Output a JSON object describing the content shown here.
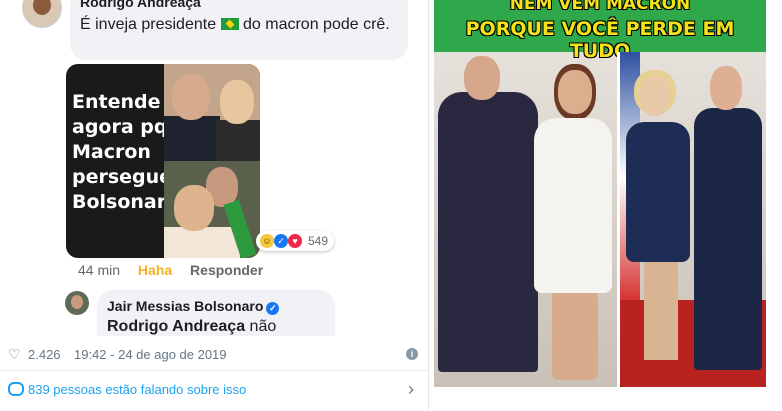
{
  "comment_1": {
    "author": "Rodrigo Andreaça",
    "text_before_flag": "É inveja presidente",
    "text_after_flag": "do macron pode crê."
  },
  "meme": {
    "text": "Entende agora pq Macron persegue Bolsonaro?"
  },
  "reactions": {
    "count": "549",
    "icons": [
      "haha-icon",
      "like-icon",
      "love-icon"
    ]
  },
  "comment_actions": {
    "time": "44 min",
    "reaction": "Haha",
    "reply": "Responder"
  },
  "comment_2": {
    "author": "Jair Messias Bolsonaro",
    "mention": "Rodrigo Andreaça",
    "text": "não"
  },
  "tweet_meta": {
    "likes": "2.426",
    "datetime": "19:42 - 24 de ago de 2019"
  },
  "talk": {
    "text": "839 pessoas estão falando sobre isso"
  },
  "right_meme": {
    "line1": "NEM VEM MACRON",
    "line2": "PORQUE VOCÊ PERDE EM TUDO"
  },
  "colors": {
    "facebook_blue": "#1877f2",
    "twitter_blue": "#1da1f2",
    "meme_yellow": "#f4e21a",
    "header_green": "#2ea84a"
  }
}
